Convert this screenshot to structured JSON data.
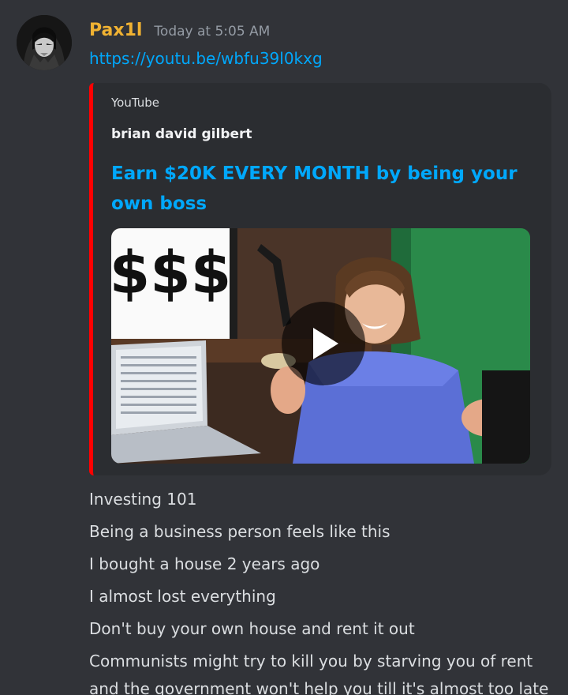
{
  "message": {
    "author": "Pax1l",
    "timestamp": "Today at 5:05 AM",
    "link": "https://youtu.be/wbfu39l0kxg",
    "avatar_icon": "anime-character-avatar"
  },
  "embed": {
    "provider": "YouTube",
    "author": "brian david gilbert",
    "title": "Earn $20K EVERY MONTH by being your own boss",
    "accent_color": "#ff0000",
    "thumbnail": {
      "overlay_text": "$$$",
      "play_icon": "play-icon"
    }
  },
  "lines": [
    "Investing 101",
    "Being a business person feels like this",
    "I bought a house 2 years ago",
    "I almost lost everything",
    "Don't buy your own house and rent it out",
    "Communists might try to kill you by starving you of rent and the government won't help you till it's almost too late"
  ],
  "colors": {
    "background": "#313338",
    "embed_background": "#2b2d31",
    "username": "#f0b232",
    "link": "#00a8fc",
    "text": "#dbdee1",
    "muted": "#949ba4"
  }
}
